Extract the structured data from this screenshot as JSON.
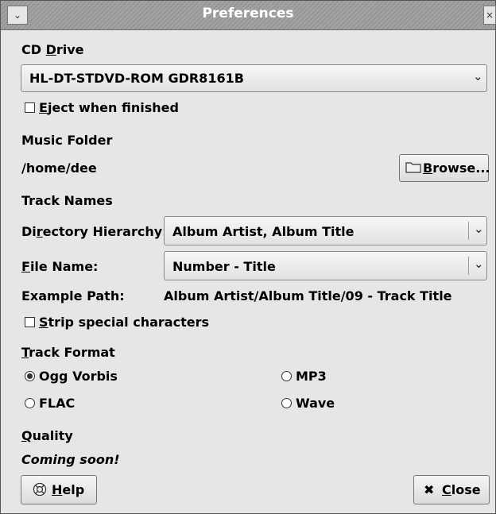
{
  "window": {
    "title": "Preferences"
  },
  "cd_drive": {
    "label_pre": "CD ",
    "label_mn": "D",
    "label_post": "rive",
    "selected": "HL-DT-STDVD-ROM GDR8161B",
    "eject_pre": "",
    "eject_mn": "E",
    "eject_post": "ject when finished",
    "eject_checked": false
  },
  "music_folder": {
    "label": "Music Folder",
    "path": "/home/dee",
    "browse_mn": "B",
    "browse_post": "rowse..."
  },
  "track_names": {
    "label": "Track Names",
    "dir_pre": "Di",
    "dir_mn": "r",
    "dir_post": "ectory Hierarchy:",
    "dir_value": "Album Artist, Album Title",
    "file_pre": "",
    "file_mn": "F",
    "file_post": "ile Name:",
    "file_value": "Number - Title",
    "example_label": "Example Path:",
    "example_value": "Album Artist/Album Title/09 - Track Title",
    "strip_pre": "",
    "strip_mn": "S",
    "strip_post": "trip special characters",
    "strip_checked": false
  },
  "track_format": {
    "label_pre": "",
    "label_mn": "T",
    "label_post": "rack Format",
    "options": [
      {
        "label": "Ogg Vorbis",
        "selected": true
      },
      {
        "label": "MP3",
        "selected": false
      },
      {
        "label": "FLAC",
        "selected": false
      },
      {
        "label": "Wave",
        "selected": false
      }
    ]
  },
  "quality": {
    "label_pre": "",
    "label_mn": "Q",
    "label_post": "uality",
    "status": "Coming soon!"
  },
  "buttons": {
    "help_mn": "H",
    "help_post": "elp",
    "close_mn": "C",
    "close_post": "lose"
  },
  "icons": {
    "window_menu": "chevron-down-icon",
    "window_close": "close-icon",
    "browse": "folder-icon",
    "help": "help-icon",
    "close": "x-icon"
  }
}
